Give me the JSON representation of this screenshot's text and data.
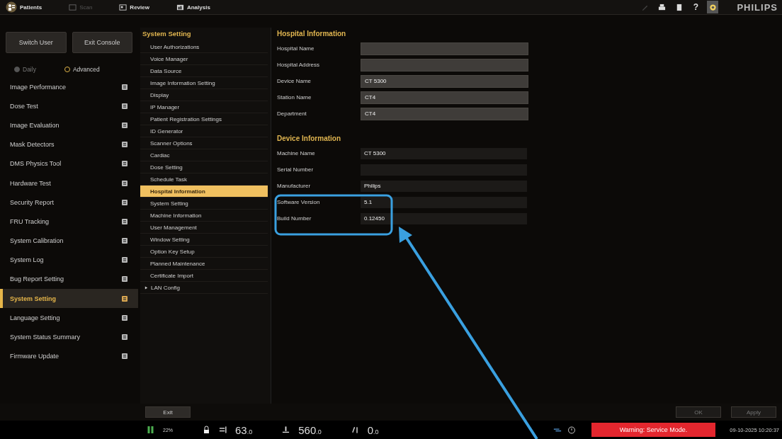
{
  "top_bar": {
    "tabs": [
      {
        "label": "Patients",
        "kind": "patients",
        "selected": false,
        "disabled": false
      },
      {
        "label": "Scan",
        "kind": "scan",
        "selected": false,
        "disabled": true
      },
      {
        "label": "Review",
        "kind": "review",
        "selected": false,
        "disabled": false
      },
      {
        "label": "Analysis",
        "kind": "analysis",
        "selected": false,
        "disabled": false
      }
    ],
    "tools": [
      {
        "kind": "pen",
        "disabled": true,
        "selected": false
      },
      {
        "kind": "printer",
        "disabled": false,
        "selected": false
      },
      {
        "kind": "document",
        "disabled": false,
        "selected": false
      },
      {
        "kind": "help",
        "label": "?",
        "disabled": false,
        "selected": false
      },
      {
        "kind": "gear",
        "disabled": false,
        "selected": true
      }
    ],
    "logo": "PHILIPS"
  },
  "sidebar": {
    "buttons": [
      "Switch User",
      "Exit Console"
    ],
    "modes": [
      {
        "label": "Daily",
        "selected": false
      },
      {
        "label": "Advanced",
        "selected": true
      }
    ],
    "items": [
      {
        "label": "Image Performance",
        "selected": false
      },
      {
        "label": "Dose Test",
        "selected": false
      },
      {
        "label": "Image Evaluation",
        "selected": false
      },
      {
        "label": "Mask Detectors",
        "selected": false
      },
      {
        "label": "DMS Physics Tool",
        "selected": false
      },
      {
        "label": "Hardware Test",
        "selected": false
      },
      {
        "label": "Security Report",
        "selected": false
      },
      {
        "label": "FRU Tracking",
        "selected": false
      },
      {
        "label": "System Calibration",
        "selected": false
      },
      {
        "label": "System Log",
        "selected": false
      },
      {
        "label": "Bug Report Setting",
        "selected": false
      },
      {
        "label": "System Setting",
        "selected": true
      },
      {
        "label": "Language Setting",
        "selected": false
      },
      {
        "label": "System Status Summary",
        "selected": false
      },
      {
        "label": "Firmware Update",
        "selected": false
      }
    ]
  },
  "submenu": {
    "title": "System Setting",
    "items": [
      {
        "label": "User Authorizations",
        "selected": false,
        "expandable": false
      },
      {
        "label": "Voice Manager",
        "selected": false,
        "expandable": false
      },
      {
        "label": "Data Source",
        "selected": false,
        "expandable": false
      },
      {
        "label": "Image Information Setting",
        "selected": false,
        "expandable": false
      },
      {
        "label": "Display",
        "selected": false,
        "expandable": false
      },
      {
        "label": "IP Manager",
        "selected": false,
        "expandable": false
      },
      {
        "label": "Patient Registration Settings",
        "selected": false,
        "expandable": false
      },
      {
        "label": "ID Generator",
        "selected": false,
        "expandable": false
      },
      {
        "label": "Scanner Options",
        "selected": false,
        "expandable": false
      },
      {
        "label": "Cardiac",
        "selected": false,
        "expandable": false
      },
      {
        "label": "Dose Setting",
        "selected": false,
        "expandable": false
      },
      {
        "label": "Schedule Task",
        "selected": false,
        "expandable": false
      },
      {
        "label": "Hospital Information",
        "selected": true,
        "expandable": false
      },
      {
        "label": "System Setting",
        "selected": false,
        "expandable": false
      },
      {
        "label": "Machine Information",
        "selected": false,
        "expandable": false
      },
      {
        "label": "User Management",
        "selected": false,
        "expandable": false
      },
      {
        "label": "Window Setting",
        "selected": false,
        "expandable": false
      },
      {
        "label": "Option Key Setup",
        "selected": false,
        "expandable": false
      },
      {
        "label": "Planned Maintenance",
        "selected": false,
        "expandable": false
      },
      {
        "label": "Certificate Import",
        "selected": false,
        "expandable": false
      },
      {
        "label": "LAN Config",
        "selected": false,
        "expandable": true
      }
    ]
  },
  "form": {
    "sections": [
      {
        "title": "Hospital Information",
        "kind": "editable",
        "fields": [
          {
            "label": "Hospital Name"
          },
          {
            "label": "Hospital Address"
          },
          {
            "label": "Device Name",
            "value": "CT 5300"
          },
          {
            "label": "Station Name",
            "value": "CT4"
          },
          {
            "label": "Department",
            "value": "CT4"
          }
        ]
      },
      {
        "title": "Device Information",
        "kind": "readonly",
        "fields": [
          {
            "label": "Machine Name",
            "value": "CT 5300"
          },
          {
            "label": "Serial Number"
          },
          {
            "label": "Manufacturer",
            "value": "Philips"
          },
          {
            "label": "Software Version",
            "value": "5.1"
          },
          {
            "label": "Build Number",
            "value": "0.12450"
          }
        ]
      }
    ]
  },
  "footer": {
    "buttons": [
      {
        "label": "Exit",
        "disabled": false
      },
      {
        "label": "OK",
        "disabled": true
      },
      {
        "label": "Apply",
        "disabled": true
      }
    ]
  },
  "status_bar": {
    "battery": "22%",
    "readings": [
      {
        "kind": "kv",
        "value": "63",
        "unit": ".0"
      },
      {
        "kind": "ma",
        "value": "560",
        "unit": ".0"
      },
      {
        "kind": "tilt",
        "value": "0",
        "unit": ".0"
      }
    ],
    "warning": "Warning: Service Mode.",
    "datetime": "09-10-2025 10:20:37"
  }
}
